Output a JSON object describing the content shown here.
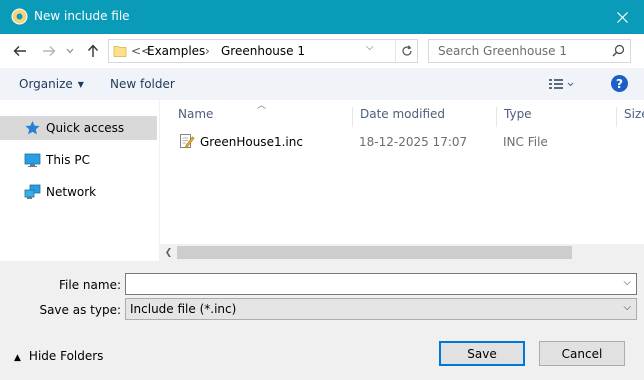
{
  "window": {
    "title": "New include file",
    "close_symbol": "✕"
  },
  "address": {
    "overflow": "<<",
    "segments": [
      "Examples",
      "Greenhouse 1"
    ],
    "separator": "›"
  },
  "search": {
    "placeholder": "Search Greenhouse 1"
  },
  "toolbar": {
    "organize_label": "Organize",
    "new_folder_label": "New folder",
    "help_label": "?"
  },
  "sidebar": {
    "items": [
      {
        "label": "Quick access",
        "icon": "star-icon"
      },
      {
        "label": "This PC",
        "icon": "computer-icon"
      },
      {
        "label": "Network",
        "icon": "network-icon"
      }
    ]
  },
  "filelist": {
    "columns": [
      "Name",
      "Date modified",
      "Type",
      "Size"
    ],
    "rows": [
      {
        "name": "GreenHouse1.inc",
        "date": "18-12-2025 17:07",
        "type": "INC File",
        "size": ""
      }
    ]
  },
  "form": {
    "file_name_label": "File name:",
    "file_name_value": "",
    "save_type_label": "Save as type:",
    "save_type_value": "Include file (*.inc)"
  },
  "footer": {
    "hide_folders_label": "Hide Folders",
    "save_label": "Save",
    "cancel_label": "Cancel"
  },
  "colors": {
    "titlebar": "#0a9bb9",
    "accent": "#0078d7",
    "toolbar_text": "#1e395b"
  }
}
